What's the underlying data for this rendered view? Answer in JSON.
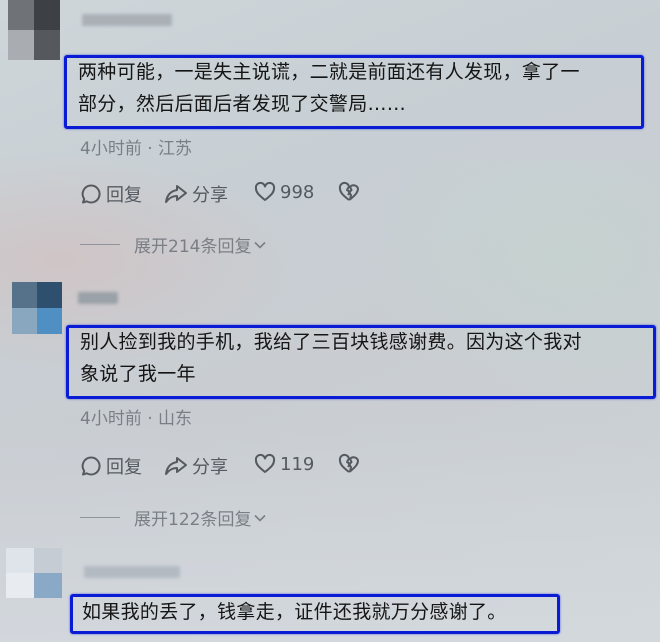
{
  "comments": [
    {
      "text_lines": [
        "两种可能，一是失主说谎，二就是前面还有人发现，拿了一",
        "部分，然后后面后者发现了交警局……"
      ],
      "time": "4小时前",
      "location": "江苏",
      "reply_label": "回复",
      "share_label": "分享",
      "like_count": "998",
      "expand_label": "展开214条回复"
    },
    {
      "text_lines": [
        "别人捡到我的手机，我给了三百块钱感谢费。因为这个我对",
        "象说了我一年"
      ],
      "time": "4小时前",
      "location": "山东",
      "reply_label": "回复",
      "share_label": "分享",
      "like_count": "119",
      "expand_label": "展开122条回复"
    },
    {
      "text_lines": [
        "如果我的丢了，钱拿走，证件还我就万分感谢了。"
      ]
    }
  ],
  "colors": {
    "highlight_border": "#0a1bd6",
    "meta_text": "#7a7f86"
  }
}
